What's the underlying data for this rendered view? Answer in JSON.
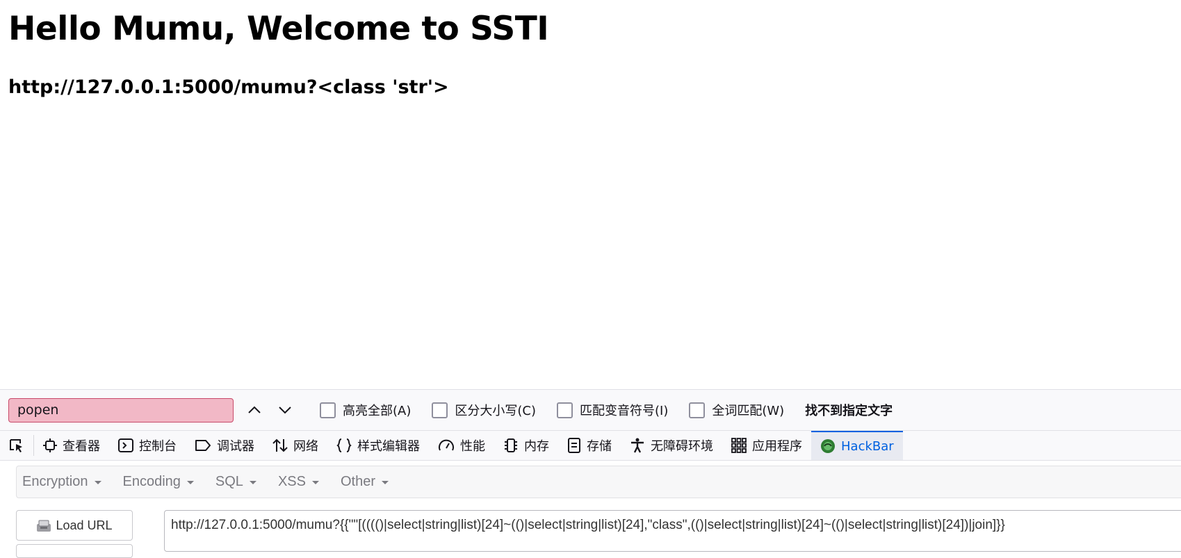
{
  "page": {
    "heading": "Hello Mumu, Welcome to SSTI",
    "subheading": "http://127.0.0.1:5000/mumu?<class 'str'>"
  },
  "findbar": {
    "query": "popen",
    "options": [
      {
        "label": "高亮全部(A)",
        "checked": false
      },
      {
        "label": "区分大小写(C)",
        "checked": false
      },
      {
        "label": "匹配变音符号(I)",
        "checked": false
      },
      {
        "label": "全词匹配(W)",
        "checked": false
      }
    ],
    "status": "找不到指定文字",
    "highlight_color": "#f2b8c6"
  },
  "devtools": {
    "tabs": [
      {
        "label": "查看器",
        "icon": "inspector-icon"
      },
      {
        "label": "控制台",
        "icon": "console-icon"
      },
      {
        "label": "调试器",
        "icon": "debugger-icon"
      },
      {
        "label": "网络",
        "icon": "network-icon"
      },
      {
        "label": "样式编辑器",
        "icon": "style-editor-icon"
      },
      {
        "label": "性能",
        "icon": "performance-icon"
      },
      {
        "label": "内存",
        "icon": "memory-icon"
      },
      {
        "label": "存储",
        "icon": "storage-icon"
      },
      {
        "label": "无障碍环境",
        "icon": "accessibility-icon"
      },
      {
        "label": "应用程序",
        "icon": "application-icon"
      },
      {
        "label": "HackBar",
        "icon": "hackbar-icon",
        "active": true
      }
    ],
    "accent_color": "#0061e0"
  },
  "hackbar": {
    "menu": [
      "Encryption",
      "Encoding",
      "SQL",
      "XSS",
      "Other"
    ],
    "load_url_label": "Load URL",
    "url_value": "http://127.0.0.1:5000/mumu?{{\"\"[(((()|select|string|list)[24]~(()|select|string|list)[24],\"class\",(()|select|string|list)[24]~(()|select|string|list)[24])|join]}}"
  }
}
